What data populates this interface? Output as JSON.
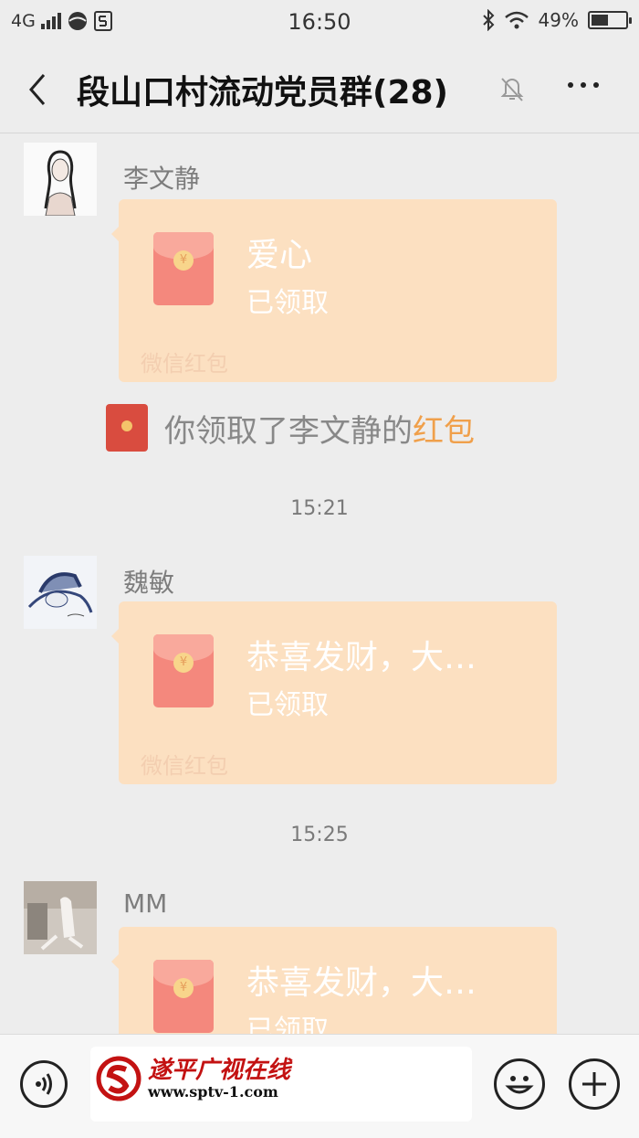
{
  "status_bar": {
    "network": "4G",
    "time": "16:50",
    "battery_percent": "49%",
    "battery_level": 0.49,
    "icons": [
      "signal-icon",
      "app-icon",
      "sim-icon",
      "bluetooth-icon",
      "wifi-icon",
      "battery-icon"
    ]
  },
  "header": {
    "title": "段山口村流动党员群(28)",
    "back_icon": "back-arrow-icon",
    "mute_icon": "mute-bell-icon",
    "more_icon": "more-icon"
  },
  "messages": [
    {
      "sender": "李文静",
      "packet_title": "爱心",
      "packet_status": "已领取",
      "packet_footer": "微信红包"
    },
    {
      "sender": "魏敏",
      "packet_title": "恭喜发财，大…",
      "packet_status": "已领取",
      "packet_footer": "微信红包"
    },
    {
      "sender": "MM",
      "packet_title": "恭喜发财，大…",
      "packet_status": "已领取",
      "packet_footer": ""
    }
  ],
  "notice": {
    "text": "你领取了李文静的",
    "link": "红包"
  },
  "timestamps": [
    "15:21",
    "15:25"
  ],
  "input_bar": {
    "voice_icon": "voice-icon",
    "emoji_icon": "emoji-icon",
    "plus_icon": "plus-icon",
    "watermark_name": "遂平广视在线",
    "watermark_url": "www.sptv-1.com"
  },
  "colors": {
    "packet": "#fce0c1",
    "link": "#f0a04b",
    "background": "#ededed"
  }
}
